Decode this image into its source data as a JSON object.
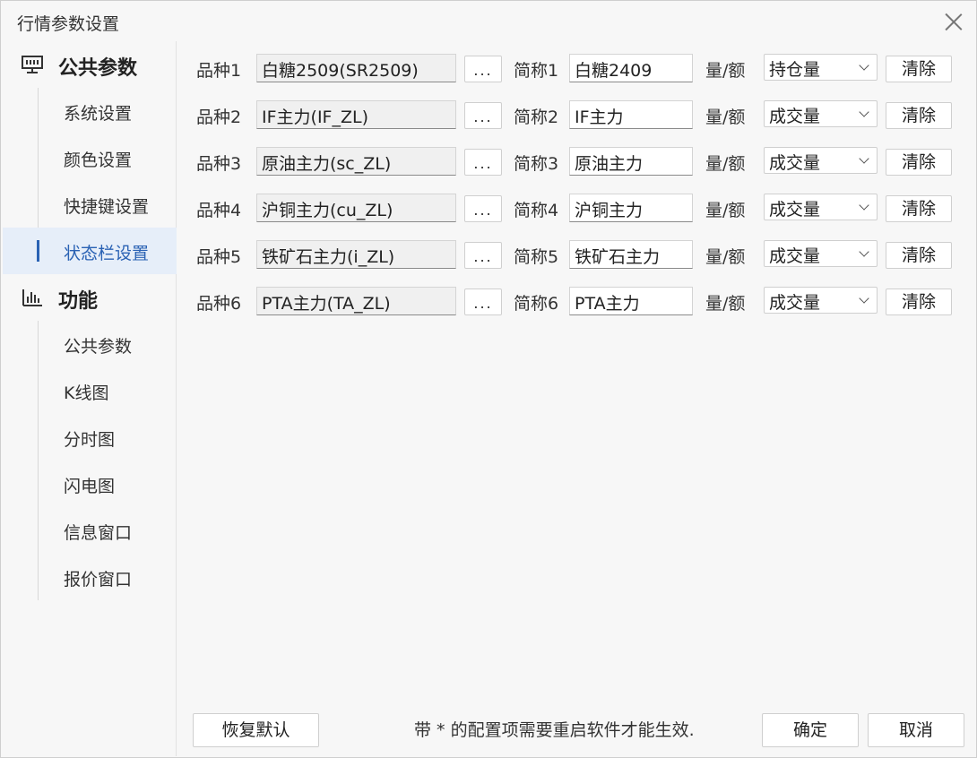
{
  "window": {
    "title": "行情参数设置"
  },
  "sidebar": {
    "groups": [
      {
        "label": "公共参数",
        "icon": "monitor-icon",
        "items": [
          {
            "label": "系统设置",
            "active": false
          },
          {
            "label": "颜色设置",
            "active": false
          },
          {
            "label": "快捷键设置",
            "active": false
          },
          {
            "label": "状态栏设置",
            "active": true
          }
        ]
      },
      {
        "label": "功能",
        "icon": "bar-chart-icon",
        "items": [
          {
            "label": "公共参数",
            "active": false
          },
          {
            "label": "K线图",
            "active": false
          },
          {
            "label": "分时图",
            "active": false
          },
          {
            "label": "闪电图",
            "active": false
          },
          {
            "label": "信息窗口",
            "active": false
          },
          {
            "label": "报价窗口",
            "active": false
          }
        ]
      }
    ]
  },
  "main": {
    "rows": [
      {
        "variety_label": "品种1",
        "variety_value": "白糖2509(SR2509)",
        "browse_label": "...",
        "abbr_label": "简称1",
        "abbr_value": "白糖2409",
        "qty_label": "量/额",
        "qty_value": "持仓量",
        "clear_label": "清除"
      },
      {
        "variety_label": "品种2",
        "variety_value": "IF主力(IF_ZL)",
        "browse_label": "...",
        "abbr_label": "简称2",
        "abbr_value": "IF主力",
        "qty_label": "量/额",
        "qty_value": "成交量",
        "clear_label": "清除"
      },
      {
        "variety_label": "品种3",
        "variety_value": "原油主力(sc_ZL)",
        "browse_label": "...",
        "abbr_label": "简称3",
        "abbr_value": "原油主力",
        "qty_label": "量/额",
        "qty_value": "成交量",
        "clear_label": "清除"
      },
      {
        "variety_label": "品种4",
        "variety_value": "沪铜主力(cu_ZL)",
        "browse_label": "...",
        "abbr_label": "简称4",
        "abbr_value": "沪铜主力",
        "qty_label": "量/额",
        "qty_value": "成交量",
        "clear_label": "清除"
      },
      {
        "variety_label": "品种5",
        "variety_value": "铁矿石主力(i_ZL)",
        "browse_label": "...",
        "abbr_label": "简称5",
        "abbr_value": "铁矿石主力",
        "qty_label": "量/额",
        "qty_value": "成交量",
        "clear_label": "清除"
      },
      {
        "variety_label": "品种6",
        "variety_value": "PTA主力(TA_ZL)",
        "browse_label": "...",
        "abbr_label": "简称6",
        "abbr_value": "PTA主力",
        "qty_label": "量/额",
        "qty_value": "成交量",
        "clear_label": "清除"
      }
    ]
  },
  "footer": {
    "restore_label": "恢复默认",
    "note": "带 * 的配置项需要重启软件才能生效.",
    "ok_label": "确定",
    "cancel_label": "取消"
  }
}
